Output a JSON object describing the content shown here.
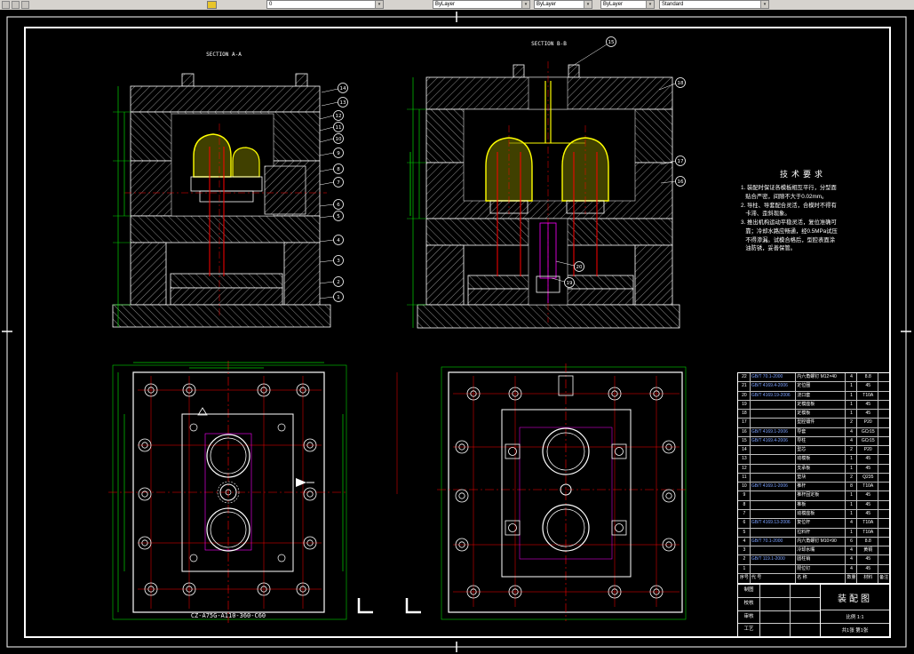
{
  "toolbar": {
    "layer_combo": "0",
    "color_combo": "ByLayer",
    "linetype_combo": "ByLayer",
    "lineweight_combo": "ByLayer",
    "style_combo": "Standard"
  },
  "drawing": {
    "section_a": "SECTION A-A",
    "section_b": "SECTION B-B",
    "part_number": "CZ-A75G-A110-360-C60",
    "balloons_a": [
      "14",
      "13",
      "12",
      "11",
      "10",
      "9",
      "8",
      "7",
      "6",
      "5",
      "4",
      "3",
      "2",
      "1"
    ],
    "balloons_b": [
      "15",
      "18",
      "17",
      "16",
      "20",
      "19"
    ],
    "tech_req": {
      "title": "技术要求",
      "lines": [
        "1. 装配时保证各模板相互平行，分型面",
        "   贴合严密，间隙不大于0.02mm。",
        "2. 导柱、导套配合灵活，合模时不得有",
        "   卡滞、歪斜现象。",
        "3. 推出机构运动平稳灵活，复位准确可",
        "   靠；冷却水路应畅通，经0.5MPa试压",
        "   不得渗漏。试模合格后，型腔表面涂",
        "   油防锈，妥善保管。"
      ]
    }
  },
  "bom": {
    "headers": [
      "序号",
      "代 号",
      "名 称",
      "数量",
      "材料",
      "备注"
    ],
    "rows": [
      [
        "22",
        "GB/T 70.1-2000",
        "内六角螺钉 M12×40",
        "4",
        "8.8",
        ""
      ],
      [
        "21",
        "GB/T 4169.4-2006",
        "定位圈",
        "1",
        "45",
        ""
      ],
      [
        "20",
        "GB/T 4169.19-2006",
        "浇口套",
        "1",
        "T10A",
        ""
      ],
      [
        "19",
        "",
        "定模座板",
        "1",
        "45",
        ""
      ],
      [
        "18",
        "",
        "定模板",
        "1",
        "45",
        ""
      ],
      [
        "17",
        "",
        "型腔镶件",
        "2",
        "P20",
        ""
      ],
      [
        "16",
        "GB/T 4169.1-2006",
        "导套",
        "4",
        "GCr15",
        ""
      ],
      [
        "15",
        "GB/T 4169.4-2006",
        "导柱",
        "4",
        "GCr15",
        ""
      ],
      [
        "14",
        "",
        "型芯",
        "2",
        "P20",
        ""
      ],
      [
        "13",
        "",
        "动模板",
        "1",
        "45",
        ""
      ],
      [
        "12",
        "",
        "支承板",
        "1",
        "45",
        ""
      ],
      [
        "11",
        "",
        "垫块",
        "2",
        "Q235",
        ""
      ],
      [
        "10",
        "GB/T 4169.1-2006",
        "推杆",
        "8",
        "T10A",
        ""
      ],
      [
        "9",
        "",
        "推杆固定板",
        "1",
        "45",
        ""
      ],
      [
        "8",
        "",
        "推板",
        "1",
        "45",
        ""
      ],
      [
        "7",
        "",
        "动模座板",
        "1",
        "45",
        ""
      ],
      [
        "6",
        "GB/T 4169.13-2006",
        "复位杆",
        "4",
        "T10A",
        ""
      ],
      [
        "5",
        "",
        "拉料杆",
        "1",
        "T10A",
        ""
      ],
      [
        "4",
        "GB/T 70.1-2000",
        "内六角螺钉 M10×90",
        "6",
        "8.8",
        ""
      ],
      [
        "3",
        "",
        "冷却水嘴",
        "4",
        "黄铜",
        ""
      ],
      [
        "2",
        "GB/T 119.1-2000",
        "圆柱销",
        "4",
        "45",
        ""
      ],
      [
        "1",
        "",
        "限位钉",
        "4",
        "45",
        ""
      ]
    ]
  },
  "title_block": {
    "name": "装配图",
    "labels": [
      "制图",
      "校核",
      "审核",
      "工艺"
    ],
    "scale": "比例 1:1",
    "sheet": "共1张 第1张"
  }
}
